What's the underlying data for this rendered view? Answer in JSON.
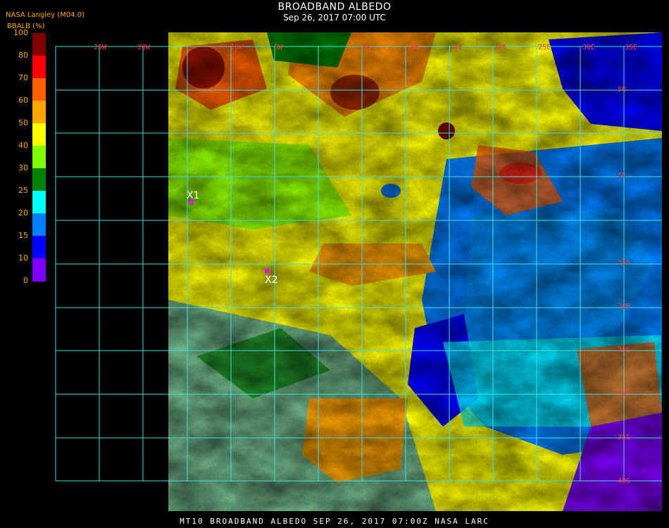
{
  "header": {
    "title": "BROADBAND ALBEDO",
    "subtitle": "Sep 26, 2017 07:00 UTC",
    "brand": "NASA Langley (M04.0)",
    "unit_label": "BBALB (%)"
  },
  "legend": {
    "ticks": [
      "100",
      "80",
      "70",
      "60",
      "50",
      "40",
      "30",
      "25",
      "20",
      "15",
      "10",
      "0"
    ],
    "colors": [
      "#800000",
      "#ff0000",
      "#ff6000",
      "#ffa500",
      "#ffff00",
      "#80ff00",
      "#008000",
      "#00ffff",
      "#0080ff",
      "#0000ff",
      "#8000ff"
    ]
  },
  "grid": {
    "lon_labels": [
      "25W",
      "20W",
      "10W",
      "5W",
      "5E",
      "10E",
      "15E",
      "20E",
      "25E",
      "30E",
      "35E"
    ],
    "lat_labels": [
      "5N",
      "5S",
      "15S",
      "20S",
      "25S",
      "30S",
      "35S",
      "40S"
    ],
    "line_color": "#40e0e0",
    "label_color": "#ff3b3b"
  },
  "markers": [
    {
      "label": "X1",
      "color": "#ff00ff"
    },
    {
      "label": "X2",
      "color": "#ff00ff"
    }
  ],
  "footer": "MT10  BROADBAND ALBEDO  SEP 26, 2017 07:00Z  NASA LARC"
}
